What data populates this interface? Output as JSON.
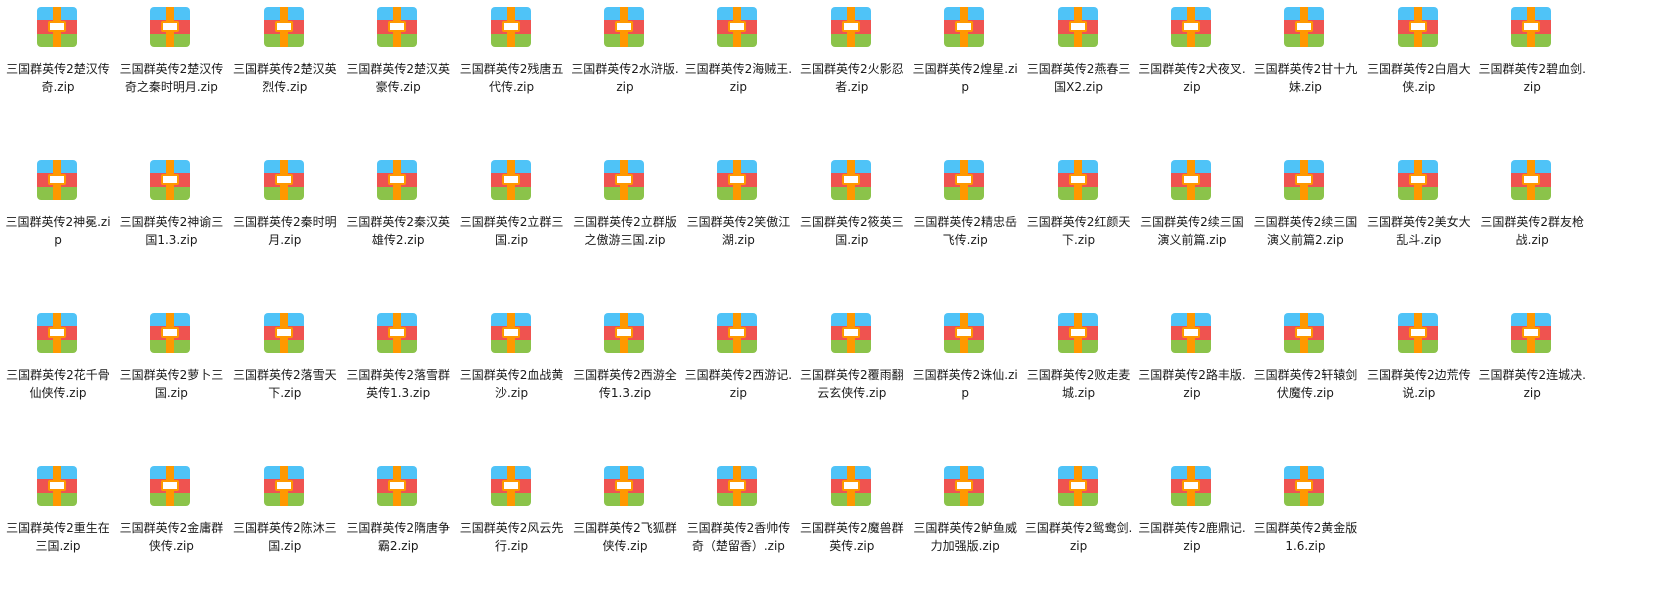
{
  "icon": "zip-archive-icon",
  "colors": {
    "band_top": "#4fc3f7",
    "band_middle": "#ef5350",
    "band_bottom": "#8bc34a",
    "strap": "#ff9800",
    "clasp": "#ffffff"
  },
  "files": [
    "三国群英传2楚汉传奇.zip",
    "三国群英传2楚汉传奇之秦时明月.zip",
    "三国群英传2楚汉英烈传.zip",
    "三国群英传2楚汉英豪传.zip",
    "三国群英传2残唐五代传.zip",
    "三国群英传2水浒版.zip",
    "三国群英传2海贼王.zip",
    "三国群英传2火影忍者.zip",
    "三国群英传2煌星.zip",
    "三国群英传2燕春三国X2.zip",
    "三国群英传2犬夜叉.zip",
    "三国群英传2甘十九妹.zip",
    "三国群英传2白眉大侠.zip",
    "三国群英传2碧血剑.zip",
    "三国群英传2神冕.zip",
    "三国群英传2神谕三国1.3.zip",
    "三国群英传2秦时明月.zip",
    "三国群英传2秦汉英雄传2.zip",
    "三国群英传2立群三国.zip",
    "三国群英传2立群版之傲游三国.zip",
    "三国群英传2笑傲江湖.zip",
    "三国群英传2筱英三国.zip",
    "三国群英传2精忠岳飞传.zip",
    "三国群英传2红颜天下.zip",
    "三国群英传2续三国演义前篇.zip",
    "三国群英传2续三国演义前篇2.zip",
    "三国群英传2美女大乱斗.zip",
    "三国群英传2群友枪战.zip",
    "三国群英传2花千骨仙侠传.zip",
    "三国群英传2萝卜三国.zip",
    "三国群英传2落雪天下.zip",
    "三国群英传2落雪群英传1.3.zip",
    "三国群英传2血战黄沙.zip",
    "三国群英传2西游全传1.3.zip",
    "三国群英传2西游记.zip",
    "三国群英传2覆雨翻云玄侠传.zip",
    "三国群英传2诛仙.zip",
    "三国群英传2败走麦城.zip",
    "三国群英传2路丰版.zip",
    "三国群英传2轩辕剑伏魔传.zip",
    "三国群英传2边荒传说.zip",
    "三国群英传2连城决.zip",
    "三国群英传2重生在三国.zip",
    "三国群英传2金庸群侠传.zip",
    "三国群英传2陈沐三国.zip",
    "三国群英传2隋唐争霸2.zip",
    "三国群英传2风云先行.zip",
    "三国群英传2飞狐群侠传.zip",
    "三国群英传2香帅传奇（楚留香）.zip",
    "三国群英传2魔兽群英传.zip",
    "三国群英传2鲈鱼威力加强版.zip",
    "三国群英传2鸳鸯剑.zip",
    "三国群英传2鹿鼎记.zip",
    "三国群英传2黄金版1.6.zip"
  ]
}
